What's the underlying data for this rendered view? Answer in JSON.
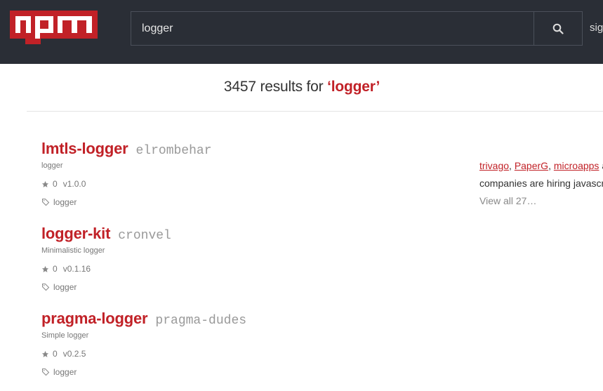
{
  "header": {
    "logo_text": "npm",
    "search": {
      "value": "logger",
      "placeholder": ""
    },
    "search_icon": "search-icon",
    "signin_label": "sig"
  },
  "results": {
    "count": "3457",
    "label": " results for ",
    "query": "‘logger’"
  },
  "packages": [
    {
      "name": "lmtls-logger",
      "author": "elrombehar",
      "description": "logger",
      "stars": "0",
      "version": "v1.0.0",
      "keyword": "logger"
    },
    {
      "name": "logger-kit",
      "author": "cronvel",
      "description": "Minimalistic logger",
      "stars": "0",
      "version": "v0.1.16",
      "keyword": "logger"
    },
    {
      "name": "pragma-logger",
      "author": "pragma-dudes",
      "description": "Simple logger",
      "stars": "0",
      "version": "v0.2.5",
      "keyword": "logger"
    }
  ],
  "sidebar": {
    "companies": [
      "trivago",
      "PaperG",
      "microapps"
    ],
    "sep": ", ",
    "tail": " a",
    "line2": "companies are hiring javascr",
    "view_all": "View all 27…"
  },
  "colors": {
    "header_bg": "#2a2e36",
    "accent": "#c12127"
  }
}
